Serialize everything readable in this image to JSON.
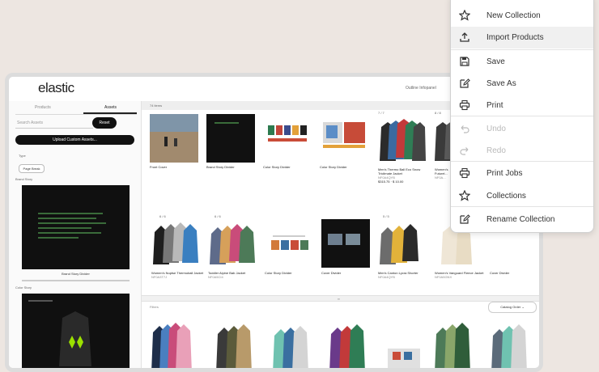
{
  "header": {
    "logo": "elastic",
    "right_text": "Outline Infopanel"
  },
  "left_panel": {
    "tabs": [
      {
        "label": "Products"
      },
      {
        "label": "Assets"
      }
    ],
    "search_placeholder": "Search Assets",
    "reset_label": "Reset",
    "upload_label": "Upload Custom Assets...",
    "type_label": "Type",
    "chip_label": "Page Break",
    "brand_label": "Brand Story",
    "asset_caption": "Brand Story Divider",
    "color_label": "Color Story"
  },
  "main": {
    "items_count": "74 items",
    "row1": [
      {
        "caption": "Front Cover"
      },
      {
        "caption": "Brand Story Divider"
      },
      {
        "caption": "Color Story Divider"
      },
      {
        "caption": "Color Story Divider"
      },
      {
        "badge": "7 / 7",
        "caption": "Men's Thermo Ball Eco Snow Triclimate Jacket",
        "sku": "NF0A4QYB",
        "price": "$315.75 · $ 10.00"
      },
      {
        "badge": "8 / 8",
        "caption": "Women's Futurel...",
        "sku": "NF0A..."
      }
    ],
    "row2": [
      {
        "badge": "6 / 6",
        "caption": "Women's Nuptse Thermoball Jacket",
        "sku": "NF0A3T7J"
      },
      {
        "badge": "6 / 6",
        "caption": "Toddler Alpine Bab Jacket",
        "sku": "NF0A5CI4"
      },
      {
        "caption": "Color Story Divider"
      },
      {
        "caption": "Cover Divider"
      },
      {
        "badge": "5 / 5",
        "caption": "Men's Canton Lycra Shorter",
        "sku": "NF0A4QYB"
      },
      {
        "caption": "Women's Vanguard Fleece Jacket",
        "sku": "NF0A5GNX"
      },
      {
        "caption": "Cover Divider"
      }
    ],
    "filters_label": "Filters",
    "catalog_order_label": "Catalog Order"
  },
  "menu": {
    "items": [
      {
        "label": "New Collection",
        "icon": "star-icon",
        "disabled": false,
        "highlighted": false
      },
      {
        "label": "Import Products",
        "icon": "upload-icon",
        "disabled": false,
        "highlighted": true
      },
      {
        "label": "Save",
        "icon": "save-icon",
        "disabled": false,
        "highlighted": false
      },
      {
        "label": "Save As",
        "icon": "edit-icon",
        "disabled": false,
        "highlighted": false
      },
      {
        "label": "Print",
        "icon": "printer-icon",
        "disabled": false,
        "highlighted": false
      },
      {
        "label": "Undo",
        "icon": "undo-icon",
        "disabled": true,
        "highlighted": false
      },
      {
        "label": "Redo",
        "icon": "redo-icon",
        "disabled": true,
        "highlighted": false
      },
      {
        "label": "Print Jobs",
        "icon": "printer-icon",
        "disabled": false,
        "highlighted": false
      },
      {
        "label": "Collections",
        "icon": "star-icon",
        "disabled": false,
        "highlighted": false
      },
      {
        "label": "Rename Collection",
        "icon": "edit-icon",
        "disabled": false,
        "highlighted": false
      }
    ]
  },
  "colors": {
    "accent": "#111111",
    "background": "#ede6e1",
    "highlight": "#f0f0f0"
  }
}
